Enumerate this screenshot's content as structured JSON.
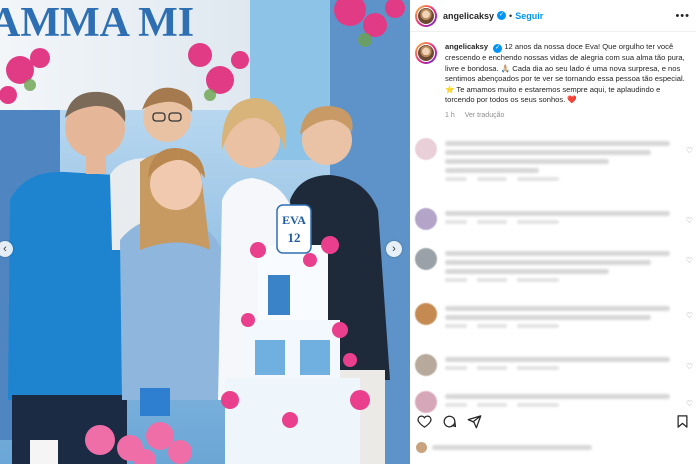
{
  "photo": {
    "banner_text": "AMMA MI",
    "cake_topper_line1": "EVA",
    "cake_topper_line2": "12"
  },
  "post": {
    "username": "angelicaksy",
    "follow_label": "Seguir",
    "caption_text": "12 anos da nossa doce Eva! Que orgulho ter você crescendo e enchendo nossas vidas de alegria com sua alma tão pura, livre e bondosa. 🙏🏼 Cada dia ao seu lado é uma nova surpresa, e nos sentimos abençoados por te ver se tornando essa pessoa tão especial. ⭐ Te amamos muito e estaremos sempre aqui, te aplaudindo e torcendo por todos os seus sonhos. ❤️",
    "time_ago": "1 h",
    "translation_label": "Ver tradução",
    "more_glyph": "•••"
  },
  "icons": {
    "verified": "verified-badge-icon",
    "heart": "heart-icon",
    "comment": "comment-icon",
    "share": "share-icon",
    "save": "bookmark-icon",
    "prev": "chevron-left-icon",
    "next": "chevron-right-icon"
  },
  "colors": {
    "accent": "#0095f6",
    "muted": "#8e8e8e",
    "text": "#262626"
  },
  "comments": [
    {
      "avatar_color": "#e9cfd7",
      "lines": 4
    },
    {
      "avatar_color": "#b3a4c8",
      "lines": 1
    },
    {
      "avatar_color": "#9aa1a8",
      "lines": 3
    },
    {
      "avatar_color": "#c48a52",
      "lines": 2
    },
    {
      "avatar_color": "#b7a99c",
      "lines": 1
    },
    {
      "avatar_color": "#d6a7b8",
      "lines": 1
    }
  ]
}
